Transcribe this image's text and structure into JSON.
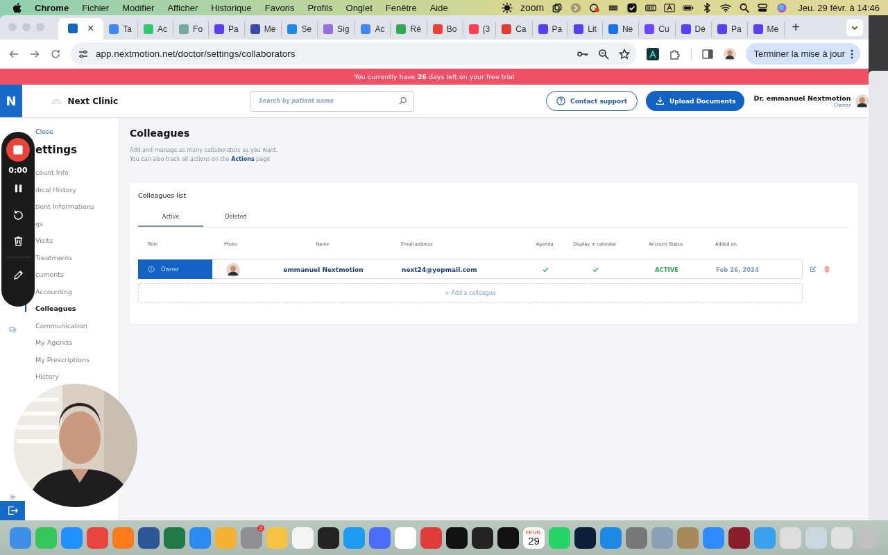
{
  "menu_bar": {
    "app": "Chrome",
    "items": [
      "Fichier",
      "Modifier",
      "Afficher",
      "Historique",
      "Favoris",
      "Profils",
      "Onglet",
      "Fenêtre",
      "Aide"
    ],
    "zoom": "zoom",
    "clock": "Jeu. 29 févr. à 14:46"
  },
  "tabs": [
    {
      "close": "×",
      "selected": true,
      "color": "#1565c0"
    },
    {
      "label": "Ta",
      "selected": false,
      "color": "#4285f4"
    },
    {
      "label": "Ac",
      "selected": false,
      "color": "#2ecc71"
    },
    {
      "label": "Fo",
      "selected": false,
      "color": "#74aa9c"
    },
    {
      "label": "Pa",
      "selected": false,
      "color": "#5b3df5"
    },
    {
      "label": "Me",
      "selected": false,
      "color": "#3949ab"
    },
    {
      "label": "Se",
      "selected": false,
      "color": "#1e88e5"
    },
    {
      "label": "Sig",
      "selected": false,
      "color": "#9b6fe0"
    },
    {
      "label": "Ac",
      "selected": false,
      "color": "#4285f4"
    },
    {
      "label": "Ré",
      "selected": false,
      "color": "#34a853"
    },
    {
      "label": "Bo",
      "selected": false,
      "color": "#ea4335"
    },
    {
      "label": "(3",
      "selected": false,
      "color": "#ff3d57"
    },
    {
      "label": "Ca",
      "selected": false,
      "color": "#e53935"
    },
    {
      "label": "Pa",
      "selected": false,
      "color": "#5b3df5"
    },
    {
      "label": "Lit",
      "selected": false,
      "color": "#5b3df5"
    },
    {
      "label": "Ne",
      "selected": false,
      "color": "#1a73e8"
    },
    {
      "label": "Cu",
      "selected": false,
      "color": "#6c47ff"
    },
    {
      "label": "Dé",
      "selected": false,
      "color": "#5b3df5"
    },
    {
      "label": "Pa",
      "selected": false,
      "color": "#5b3df5"
    },
    {
      "label": "Me",
      "selected": false,
      "color": "#5b3df5"
    }
  ],
  "new_tab": "+",
  "address_bar": {
    "url": "app.nextmotion.net/doctor/settings/collaborators",
    "update_button": "Terminer la mise à jour"
  },
  "trial_banner": "You currently have **26** days left on your free trial",
  "header": {
    "logo": "N",
    "clinic": "Next Clinic",
    "search": {
      "placeholder": "Search by patient name"
    },
    "contact_button": "Contact support",
    "upload_button": "Upload Documents",
    "user": {
      "name": "Dr. emmanuel Nextmotion",
      "role": "Owner"
    }
  },
  "sidebar": {
    "close": "Close",
    "title": "ettings",
    "items": [
      {
        "label": "count Info",
        "selected": false
      },
      {
        "label": "dical History",
        "selected": false
      },
      {
        "label": "tient Informations",
        "selected": false
      },
      {
        "label": "gs",
        "selected": false
      },
      {
        "label": "Visits",
        "selected": false
      },
      {
        "label": "Treatments",
        "selected": false
      },
      {
        "label": "cuments",
        "selected": false
      },
      {
        "label": "Accounting",
        "selected": false
      },
      {
        "label": "Colleagues",
        "selected": true
      },
      {
        "label": "Communication",
        "selected": false
      },
      {
        "label": "My Agenda",
        "selected": false
      },
      {
        "label": "My Prescriptions",
        "selected": false
      },
      {
        "label": "History",
        "selected": false
      }
    ]
  },
  "page": {
    "title": "Colleagues",
    "description": "Add and manage as many collaborators as you want.",
    "track_text": "You can also track all actions on the **Actions** page"
  },
  "colleagues_card": {
    "title": "Colleagues list",
    "tabs": [
      {
        "label": "Active",
        "selected": true
      },
      {
        "label": "Deleted",
        "selected": false
      }
    ],
    "columns": [
      "Role",
      "Photo",
      "Name",
      "Email address",
      "Agenda",
      "Display in calendar",
      "Account Status",
      "Added on"
    ],
    "rows": [
      {
        "role": "Owner",
        "name": "emmanuel Nextmotion",
        "email": "next24@yopmail.com",
        "agenda": true,
        "display_in_calendar": true,
        "status": "ACTIVE",
        "added_on": "Feb 26, 2024"
      }
    ],
    "add_button": "+ Add a colleague"
  },
  "recorder": {
    "time": "0:00"
  },
  "dock": [
    {
      "kind": "app"
    },
    {
      "kind": "app"
    },
    {
      "kind": "app"
    },
    {
      "kind": "app"
    },
    {
      "kind": "app"
    },
    {
      "kind": "app"
    },
    {
      "kind": "app"
    },
    {
      "kind": "app"
    },
    {
      "kind": "app"
    },
    {
      "kind": "app",
      "badge": "2"
    },
    {
      "kind": "app"
    },
    {
      "kind": "app"
    },
    {
      "kind": "app"
    },
    {
      "kind": "app"
    },
    {
      "kind": "app"
    },
    {
      "kind": "app"
    },
    {
      "kind": "app"
    },
    {
      "kind": "app"
    },
    {
      "kind": "app"
    },
    {
      "kind": "app"
    },
    {
      "kind": "calendar",
      "month": "FÉVR.",
      "day": "29"
    },
    {
      "kind": "app"
    },
    {
      "kind": "app"
    },
    {
      "kind": "app"
    },
    {
      "kind": "app"
    },
    {
      "kind": "app"
    },
    {
      "kind": "app"
    },
    {
      "kind": "app"
    },
    {
      "kind": "app"
    },
    {
      "kind": "app"
    },
    {
      "kind": "app"
    },
    {
      "kind": "app"
    },
    {
      "kind": "app"
    },
    {
      "kind": "app"
    }
  ]
}
